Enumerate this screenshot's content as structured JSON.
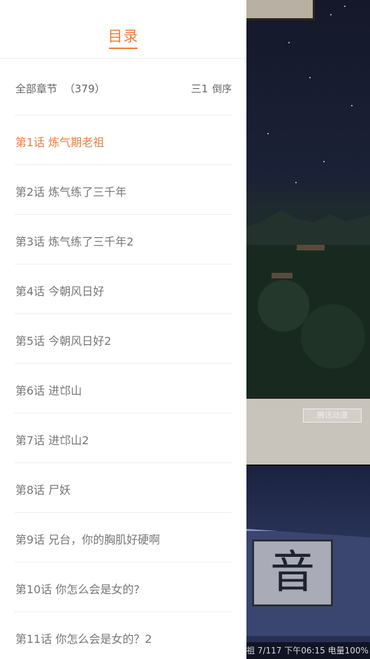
{
  "toc": {
    "title": "目录",
    "summary_label": "全部章节",
    "chapter_count": "（379）",
    "sort_label": "倒序",
    "sort_icon": "sort-descending-icon"
  },
  "chapters": [
    {
      "label": "第1话 炼气期老祖",
      "active": true
    },
    {
      "label": "第2话 炼气练了三千年",
      "active": false
    },
    {
      "label": "第3话 炼气练了三千年2",
      "active": false
    },
    {
      "label": "第4话 今朝风日好",
      "active": false
    },
    {
      "label": "第5话 今朝风日好2",
      "active": false
    },
    {
      "label": "第6话 进邙山",
      "active": false
    },
    {
      "label": "第7话 进邙山2",
      "active": false
    },
    {
      "label": "第8话 尸妖",
      "active": false
    },
    {
      "label": "第9话 兄台，你的胸肌好硬啊",
      "active": false
    },
    {
      "label": "第10话 你怎么会是女的?",
      "active": false
    },
    {
      "label": "第11话 你怎么会是女的？2",
      "active": false
    }
  ],
  "reader_status": {
    "text": "祖 7/117 下午06:15 电量100%"
  },
  "comic": {
    "plaque_char": "音",
    "watermark_text": "腾讯动漫"
  },
  "colors": {
    "accent": "#f07e3a",
    "text_muted": "#777777",
    "divider": "#eeeeee"
  }
}
